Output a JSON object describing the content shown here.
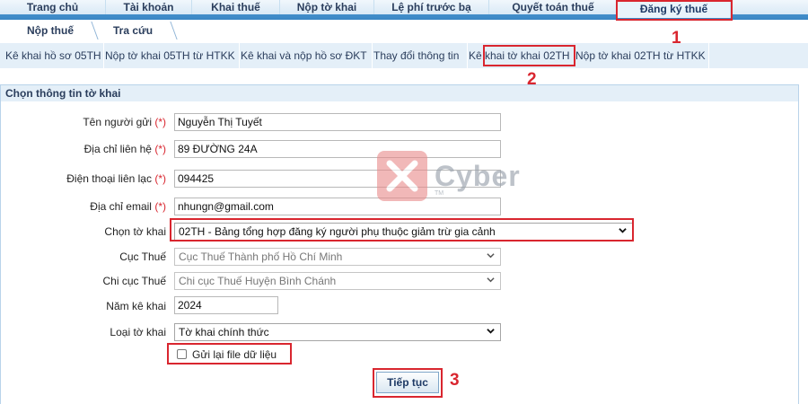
{
  "top_nav": [
    "Trang chủ",
    "Tài khoản",
    "Khai thuế",
    "Nộp tờ khai",
    "Lệ phí trước bạ",
    "Quyết toán thuế",
    "Đăng ký thuế"
  ],
  "sub_nav": [
    "Nộp thuế",
    "Tra cứu"
  ],
  "third_nav": [
    "Kê khai hồ sơ 05TH",
    "Nộp tờ khai 05TH từ HTKK",
    "Kê khai và nộp hồ sơ ĐKT",
    "Thay đổi thông tin",
    "Kê",
    "khai tờ khai 02TH",
    "Nộp tờ khai 02TH từ HTKK"
  ],
  "panel_title": "Chọn thông tin tờ khai",
  "required_mark": "(*)",
  "form": {
    "sender_name": {
      "label": "Tên người gửi",
      "value": "Nguyễn Thị Tuyết"
    },
    "address": {
      "label": "Địa chỉ liên hệ",
      "value": "89 ĐƯỜNG 24A"
    },
    "phone": {
      "label": "Điện thoại liên lạc",
      "value": "094425"
    },
    "email": {
      "label": "Địa chỉ email",
      "value": "nhungn@gmail.com"
    },
    "form_select": {
      "label": "Chọn tờ khai",
      "value": "02TH - Bảng tổng hợp đăng ký người phụ thuộc giảm trừ gia cảnh"
    },
    "tax_dept": {
      "label": "Cục Thuế",
      "value": "Cục Thuế Thành phố Hồ Chí Minh"
    },
    "tax_branch": {
      "label": "Chi cục Thuế",
      "value": "Chi cục Thuế Huyện Bình Chánh"
    },
    "year": {
      "label": "Năm kê khai",
      "value": "2024"
    },
    "form_type": {
      "label": "Loại tờ khai",
      "value": "Tờ khai chính thức"
    },
    "resend_checkbox": {
      "label": "Gửi lại file dữ liệu"
    },
    "continue_button": "Tiếp tục"
  },
  "annotations": [
    "1",
    "2",
    "3"
  ],
  "watermark": {
    "text": "Cyber",
    "tm": "TM"
  },
  "colors": {
    "annotation_red": "#d9262f",
    "nav_blue": "#3a86c4",
    "panel_bg": "#e4eff8"
  }
}
